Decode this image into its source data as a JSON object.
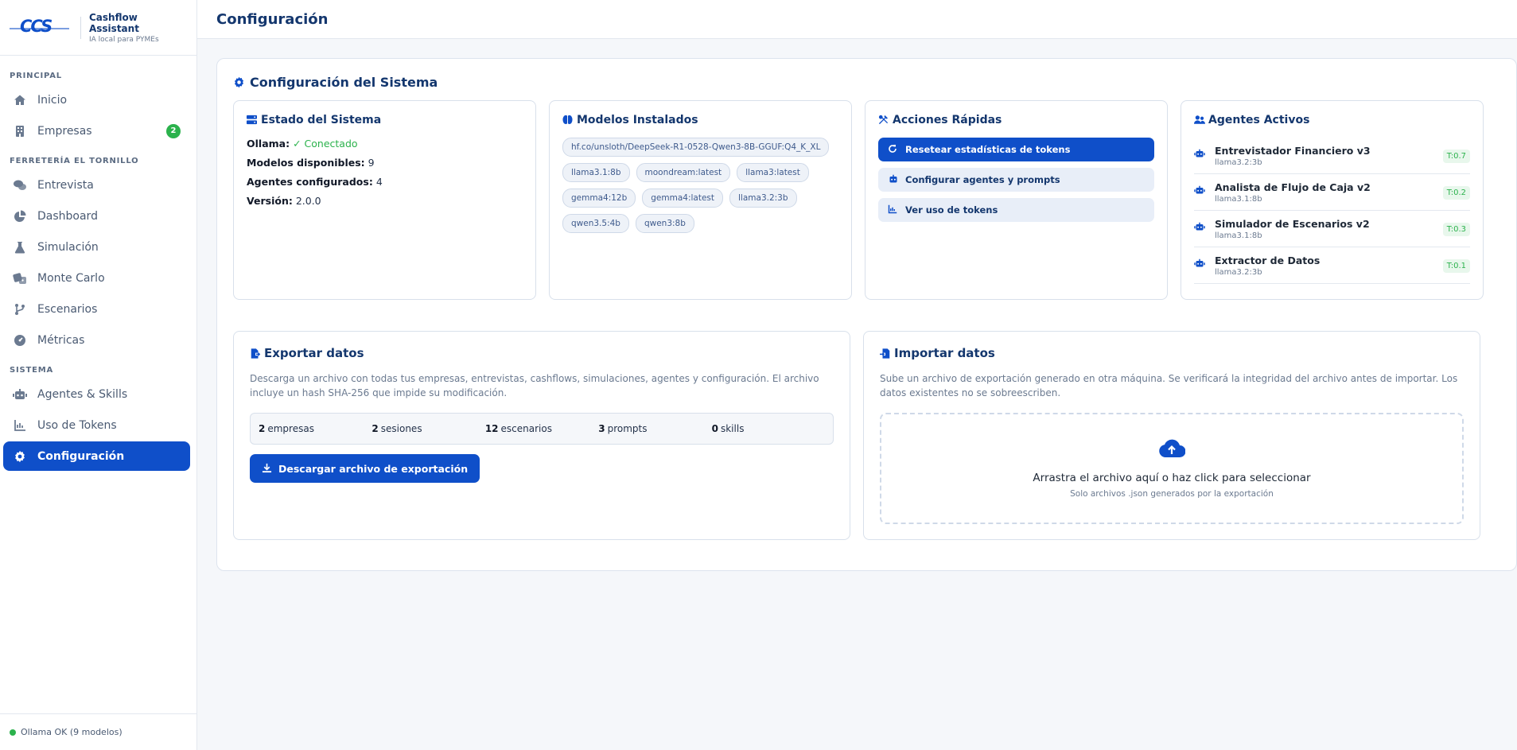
{
  "brand": {
    "logo_text": "CCS",
    "name": "Cashflow Assistant",
    "subtitle": "IA local para PYMEs"
  },
  "sidebar": {
    "section_principal": "PRINCIPAL",
    "section_empresa": "FERRETERÍA EL TORNILLO",
    "section_sistema": "SISTEMA",
    "items": [
      {
        "label": "Inicio",
        "icon": "home-icon"
      },
      {
        "label": "Empresas",
        "icon": "building-icon",
        "badge": "2"
      },
      {
        "label": "Entrevista",
        "icon": "chat-icon"
      },
      {
        "label": "Dashboard",
        "icon": "pie-chart-icon"
      },
      {
        "label": "Simulación",
        "icon": "flask-icon"
      },
      {
        "label": "Monte Carlo",
        "icon": "dice-icon"
      },
      {
        "label": "Escenarios",
        "icon": "branch-icon"
      },
      {
        "label": "Métricas",
        "icon": "gauge-icon"
      },
      {
        "label": "Agentes & Skills",
        "icon": "robot-icon"
      },
      {
        "label": "Uso de Tokens",
        "icon": "chart-line-icon"
      },
      {
        "label": "Configuración",
        "icon": "gear-icon",
        "active": true
      }
    ],
    "footer_status": "Ollama OK (9 modelos)"
  },
  "header": {
    "title": "Configuración"
  },
  "panel": {
    "title": "Configuración del Sistema"
  },
  "estado": {
    "title": "Estado del Sistema",
    "ollama_label": "Ollama:",
    "ollama_value": "✓ Conectado",
    "modelos_label": "Modelos disponibles:",
    "modelos_value": "9",
    "agentes_label": "Agentes configurados:",
    "agentes_value": "4",
    "version_label": "Versión:",
    "version_value": "2.0.0"
  },
  "modelos": {
    "title": "Modelos Instalados",
    "list": [
      "hf.co/unsloth/DeepSeek-R1-0528-Qwen3-8B-GGUF:Q4_K_XL",
      "llama3.1:8b",
      "moondream:latest",
      "llama3:latest",
      "gemma4:12b",
      "gemma4:latest",
      "llama3.2:3b",
      "qwen3.5:4b",
      "qwen3:8b"
    ]
  },
  "acciones": {
    "title": "Acciones Rápidas",
    "reset_label": "Resetear estadísticas de tokens",
    "config_label": "Configurar agentes y prompts",
    "ver_label": "Ver uso de tokens"
  },
  "agentes": {
    "title": "Agentes Activos",
    "list": [
      {
        "name": "Entrevistador Financiero v3",
        "model": "llama3.2:3b",
        "temp": "T:0.7"
      },
      {
        "name": "Analista de Flujo de Caja v2",
        "model": "llama3.1:8b",
        "temp": "T:0.2"
      },
      {
        "name": "Simulador de Escenarios v2",
        "model": "llama3.1:8b",
        "temp": "T:0.3"
      },
      {
        "name": "Extractor de Datos",
        "model": "llama3.2:3b",
        "temp": "T:0.1"
      }
    ]
  },
  "exportar": {
    "title": "Exportar datos",
    "description": "Descarga un archivo con todas tus empresas, entrevistas, cashflows, simulaciones, agentes y configuración. El archivo incluye un hash SHA-256 que impide su modificación.",
    "stats": [
      {
        "value": "2",
        "label": "empresas"
      },
      {
        "value": "2",
        "label": "sesiones"
      },
      {
        "value": "12",
        "label": "escenarios"
      },
      {
        "value": "3",
        "label": "prompts"
      },
      {
        "value": "0",
        "label": "skills"
      }
    ],
    "button_label": "Descargar archivo de exportación"
  },
  "importar": {
    "title": "Importar datos",
    "description": "Sube un archivo de exportación generado en otra máquina. Se verificará la integridad del archivo antes de importar. Los datos existentes no se sobreescriben.",
    "drop_title": "Arrastra el archivo aquí o haz click para seleccionar",
    "drop_sub": "Solo archivos .json generados por la exportación"
  },
  "colors": {
    "accent": "#0f4fc9",
    "success": "#2bb24c",
    "heading": "#14376e"
  }
}
